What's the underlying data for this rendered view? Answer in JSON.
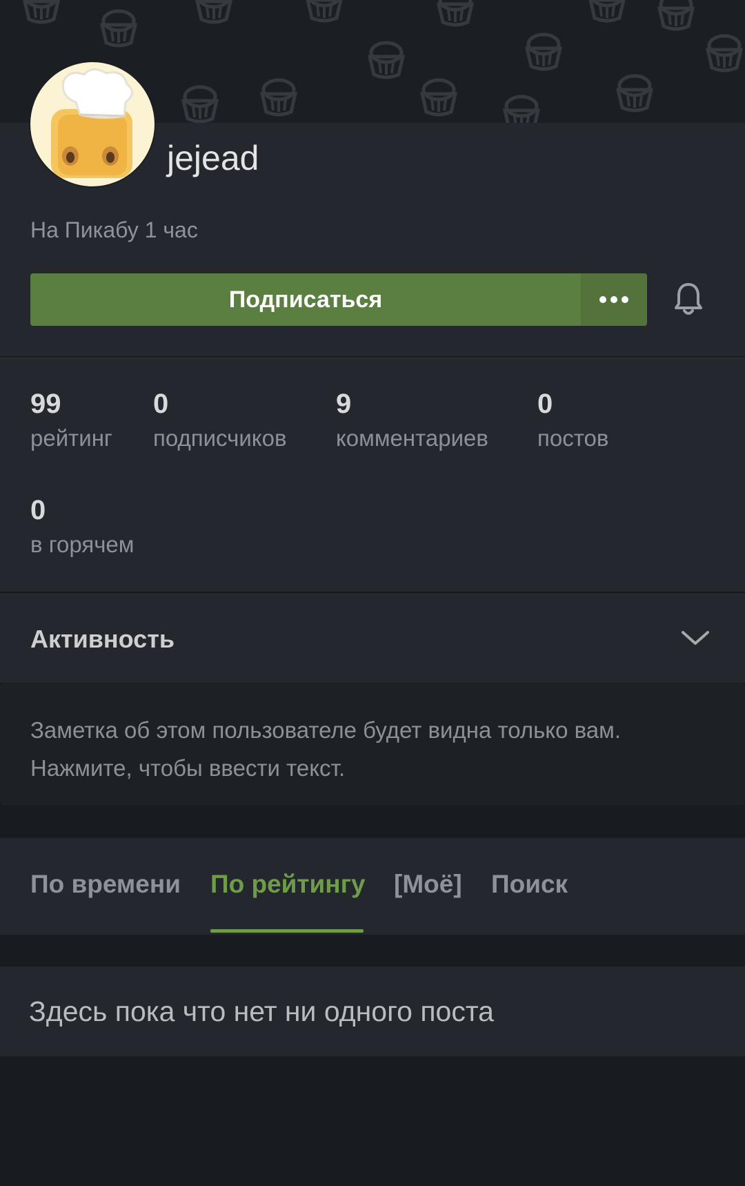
{
  "profile": {
    "username": "jejead",
    "since": "На Пикабу 1 час",
    "subscribe_label": "Подписаться",
    "more_icon": "more-dots-icon",
    "bell_icon": "bell-icon"
  },
  "stats": [
    {
      "value": "99",
      "label": "рейтинг"
    },
    {
      "value": "0",
      "label": "подписчиков"
    },
    {
      "value": "9",
      "label": "комментариев"
    },
    {
      "value": "0",
      "label": "постов"
    },
    {
      "value": "0",
      "label": "в горячем"
    }
  ],
  "activity": {
    "title": "Активность",
    "chevron_icon": "chevron-down-icon"
  },
  "note": {
    "text": "Заметка об этом пользователе будет видна только вам. Нажмите, чтобы ввести текст."
  },
  "tabs": [
    {
      "label": "По времени",
      "active": false
    },
    {
      "label": "По рейтингу",
      "active": true
    },
    {
      "label": "[Моё]",
      "active": false
    },
    {
      "label": "Поиск",
      "active": false
    }
  ],
  "empty_state": {
    "text": "Здесь пока что нет ни одного поста"
  },
  "colors": {
    "accent": "#5b7e41",
    "accent_text": "#6e9c48",
    "panel": "#24282e",
    "background": "#181b1f"
  }
}
